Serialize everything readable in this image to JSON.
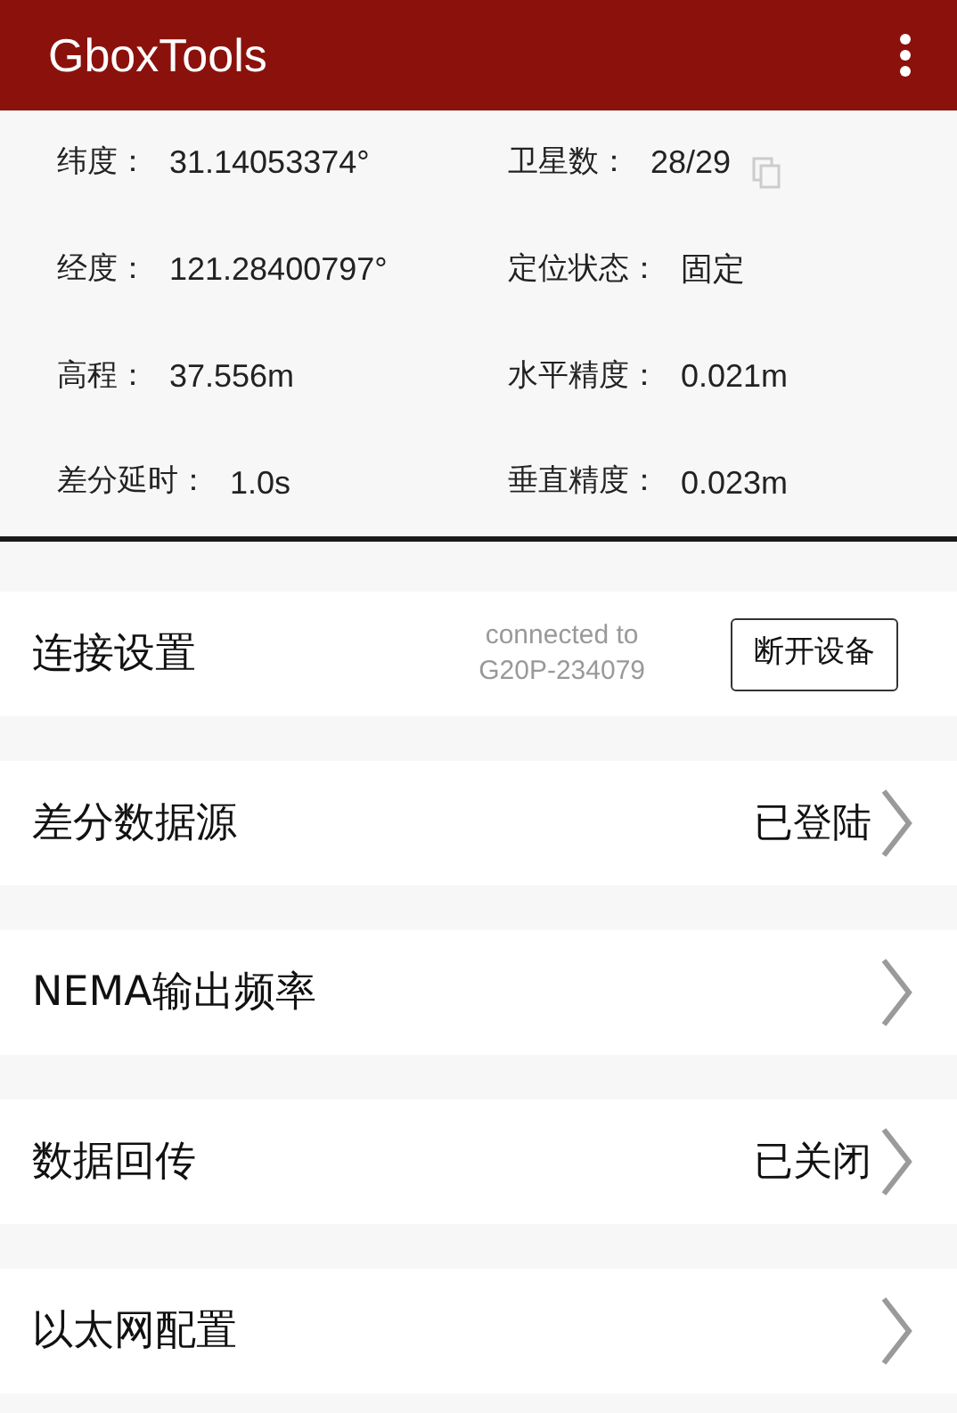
{
  "app_bar": {
    "title": "GboxTools"
  },
  "status": [
    {
      "label": "纬度：",
      "value": "31.14053374°"
    },
    {
      "label": "卫星数：",
      "value": "28/29",
      "copy": true
    },
    {
      "label": "经度：",
      "value": "121.28400797°"
    },
    {
      "label": "定位状态：",
      "value": "固定"
    },
    {
      "label": "高程：",
      "value": "37.556m"
    },
    {
      "label": "水平精度：",
      "value": "0.021m"
    },
    {
      "label": "差分延时：",
      "value": "1.0s"
    },
    {
      "label": "垂直精度：",
      "value": "0.023m"
    }
  ],
  "connection": {
    "title": "连接设置",
    "status_lines": [
      "connected to",
      "G20P-234079"
    ],
    "button": "断开设备"
  },
  "settings": [
    {
      "title": "差分数据源",
      "value": "已登陆"
    },
    {
      "title": "NEMA输出频率"
    },
    {
      "title": "数据回传",
      "value": "已关闭"
    },
    {
      "title": "以太网配置"
    }
  ]
}
